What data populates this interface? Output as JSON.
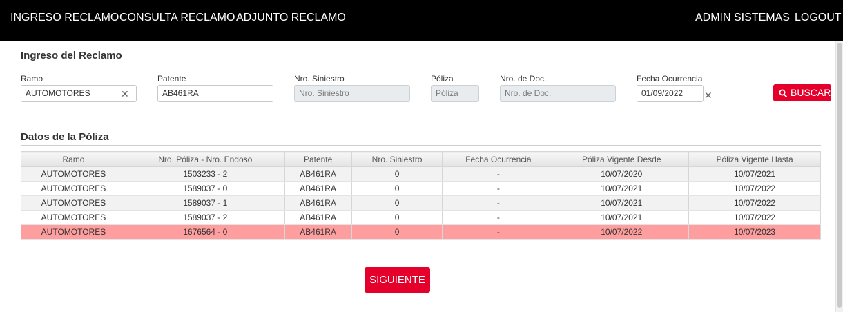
{
  "nav": {
    "left": [
      "INGRESO RECLAMO",
      "CONSULTA RECLAMO",
      "ADJUNTO RECLAMO"
    ],
    "right": [
      "ADMIN SISTEMAS",
      "LOGOUT"
    ]
  },
  "ingreso": {
    "title": "Ingreso del Reclamo",
    "fields": {
      "ramo": {
        "label": "Ramo",
        "value": "AUTOMOTORES"
      },
      "patente": {
        "label": "Patente",
        "value": "AB461RA"
      },
      "siniestro": {
        "label": "Nro. Siniestro",
        "placeholder": "Nro. Siniestro"
      },
      "poliza": {
        "label": "Póliza",
        "placeholder": "Póliza"
      },
      "documento": {
        "label": "Nro. de Doc.",
        "placeholder": "Nro. de Doc."
      },
      "fecha": {
        "label": "Fecha Ocurrencia",
        "value": "01/09/2022"
      }
    },
    "buscar_label": "BUSCAR",
    "clear_glyph": "✕"
  },
  "datos": {
    "title": "Datos de la Póliza",
    "columns": [
      "Ramo",
      "Nro. Póliza - Nro. Endoso",
      "Patente",
      "Nro. Siniestro",
      "Fecha Ocurrencia",
      "Póliza Vigente Desde",
      "Póliza Vigente Hasta"
    ],
    "rows": [
      [
        "AUTOMOTORES",
        "1503233 - 2",
        "AB461RA",
        "0",
        "-",
        "10/07/2020",
        "10/07/2021"
      ],
      [
        "AUTOMOTORES",
        "1589037 - 0",
        "AB461RA",
        "0",
        "-",
        "10/07/2021",
        "10/07/2022"
      ],
      [
        "AUTOMOTORES",
        "1589037 - 1",
        "AB461RA",
        "0",
        "-",
        "10/07/2021",
        "10/07/2022"
      ],
      [
        "AUTOMOTORES",
        "1589037 - 2",
        "AB461RA",
        "0",
        "-",
        "10/07/2021",
        "10/07/2022"
      ],
      [
        "AUTOMOTORES",
        "1676564 - 0",
        "AB461RA",
        "0",
        "-",
        "10/07/2022",
        "10/07/2023"
      ]
    ],
    "selected_row": 4
  },
  "siguiente_label": "SIGUIENTE",
  "colors": {
    "accent": "#e4002b",
    "topbar": "#000000",
    "selected_row": "#ff9e9e"
  },
  "icons": {
    "buscar": "search-icon",
    "clear": "close-icon"
  }
}
